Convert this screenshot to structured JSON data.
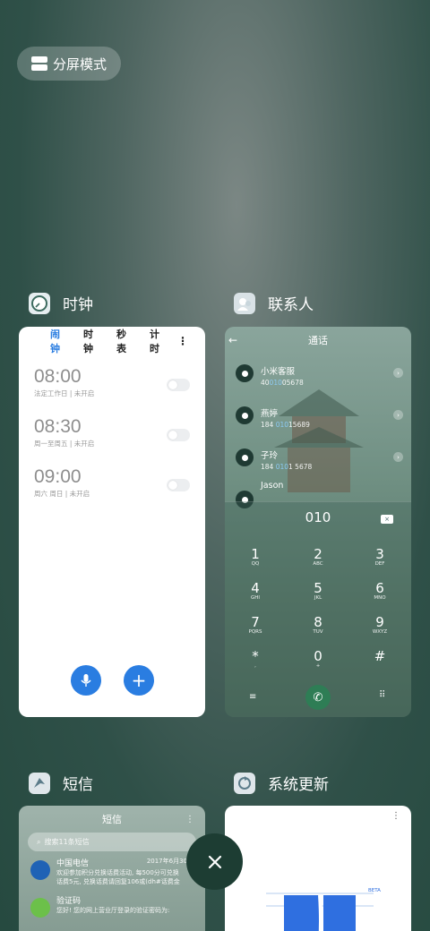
{
  "split_mode": {
    "label": "分屏模式"
  },
  "apps": {
    "clock": {
      "title": "时钟"
    },
    "contacts": {
      "title": "联系人"
    },
    "sms": {
      "title": "短信"
    },
    "update": {
      "title": "系统更新"
    }
  },
  "clock_card": {
    "tabs": [
      "闹钟",
      "时钟",
      "秒表",
      "计时"
    ],
    "more": "⋮",
    "alarms": [
      {
        "time": "08:00",
        "desc": "法定工作日 | 未开启"
      },
      {
        "time": "08:30",
        "desc": "周一至周五 | 未开启"
      },
      {
        "time": "09:00",
        "desc": "周六 周日 | 未开启"
      }
    ]
  },
  "contacts_card": {
    "title": "通话",
    "contacts": [
      {
        "name": "小米客服",
        "num_a": "40",
        "num_b": "010",
        "num_c": "05678"
      },
      {
        "name": "燕婷",
        "num_a": "184 ",
        "num_b": "010",
        "num_c": "15689"
      },
      {
        "name": "子玲",
        "num_a": "184 ",
        "num_b": "010",
        "num_c": "1 5678"
      },
      {
        "name": "Jason",
        "num_a": "",
        "num_b": "",
        "num_c": ""
      }
    ],
    "dial_input": "010",
    "keys": [
      {
        "d": "1",
        "l": "QQ"
      },
      {
        "d": "2",
        "l": "ABC"
      },
      {
        "d": "3",
        "l": "DEF"
      },
      {
        "d": "4",
        "l": "GHI"
      },
      {
        "d": "5",
        "l": "JKL"
      },
      {
        "d": "6",
        "l": "MNO"
      },
      {
        "d": "7",
        "l": "PQRS"
      },
      {
        "d": "8",
        "l": "TUV"
      },
      {
        "d": "9",
        "l": "WXYZ"
      },
      {
        "d": "*",
        "l": ","
      },
      {
        "d": "0",
        "l": "+"
      },
      {
        "d": "#",
        "l": ""
      }
    ]
  },
  "sms_card": {
    "title": "短信",
    "search_placeholder": "搜索11条短信",
    "messages": [
      {
        "name": "中国电信",
        "time": "2017年6月30",
        "preview1": "欢迎参加积分兑换话费活动, 每500分可兑换",
        "preview2": "话费5元, 兑换话费请回复106或(dh#话费金"
      },
      {
        "name": "验证码",
        "time": "",
        "preview1": "您好! 您的网上营业厅登录的验证密码为:",
        "preview2": ""
      }
    ]
  },
  "update_card": {
    "badge": "BETA"
  },
  "colors": {
    "accent": "#2a7de1",
    "close_bg": "#1d3d33"
  },
  "icons": [
    "split-screen-icon",
    "clock-app-icon",
    "contacts-app-icon",
    "sms-app-icon",
    "update-app-icon",
    "close-icon",
    "mic-icon",
    "plus-icon",
    "phone-icon"
  ]
}
